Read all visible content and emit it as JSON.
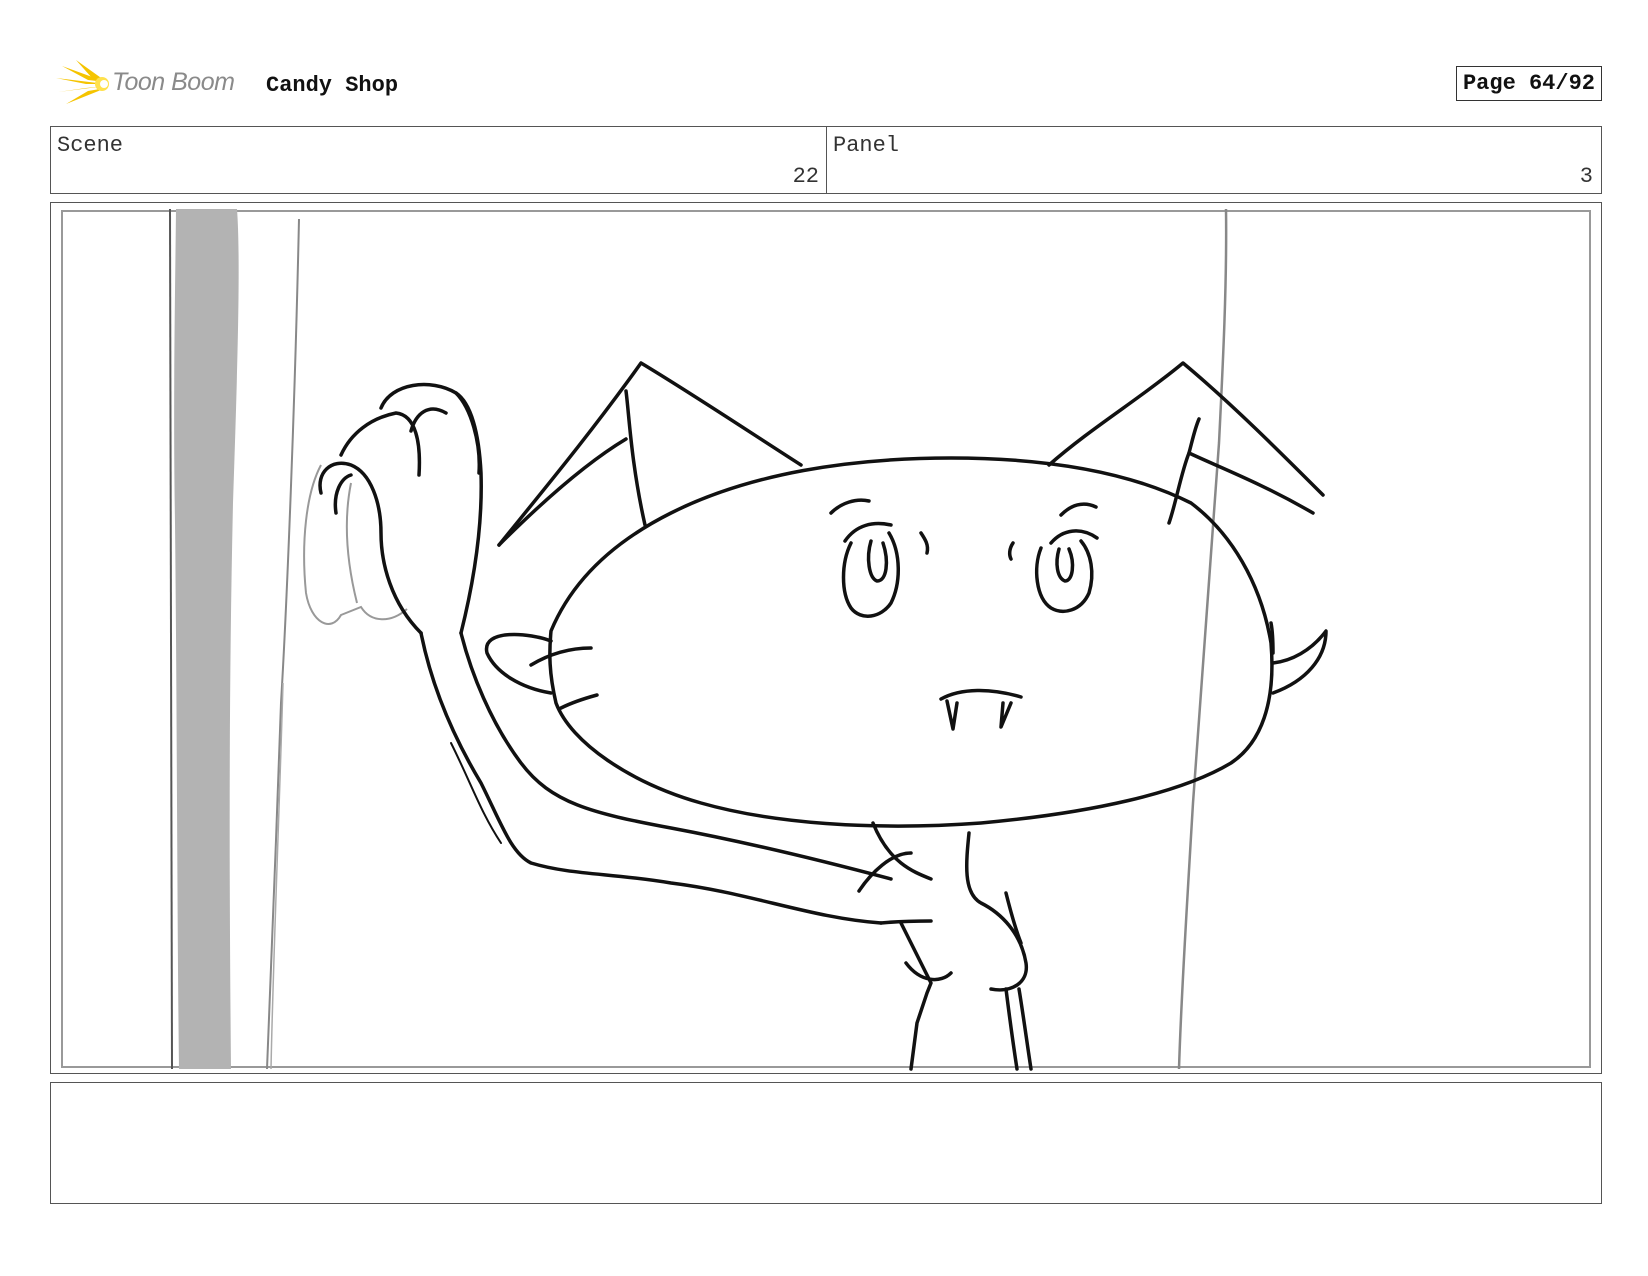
{
  "header": {
    "logo_text": "Toon Boom",
    "project_title": "Candy Shop",
    "page_label": "Page 64/92"
  },
  "info": {
    "scene_label": "Scene",
    "scene_value": "22",
    "panel_label": "Panel",
    "panel_value": "3"
  },
  "colors": {
    "logo_burst": "#f5c400",
    "logo_text": "#8a8a8a",
    "sketch_line": "#111111",
    "wall_shade": "#b3b3b3"
  },
  "notes": {
    "text": ""
  }
}
